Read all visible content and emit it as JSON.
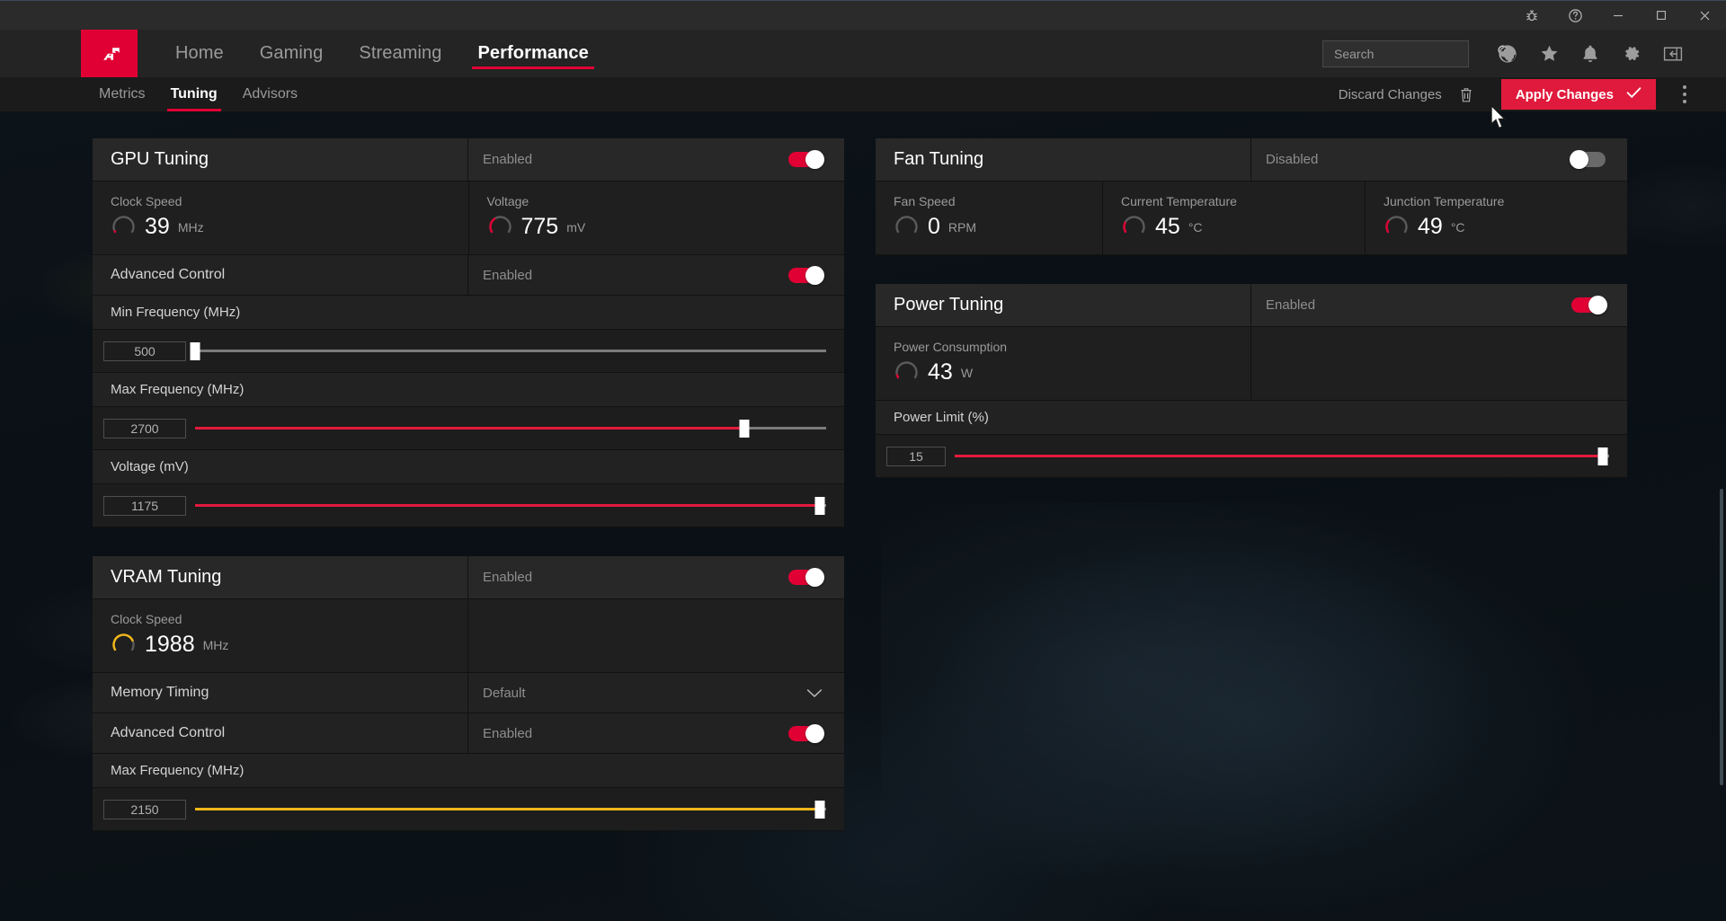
{
  "titlebar": {
    "buttons": [
      {
        "name": "bug-report-icon",
        "label": "Bug Report"
      },
      {
        "name": "help-icon",
        "label": "Help"
      },
      {
        "name": "minimize-icon",
        "label": "Minimize"
      },
      {
        "name": "maximize-icon",
        "label": "Maximize"
      },
      {
        "name": "close-icon",
        "label": "Close"
      }
    ]
  },
  "brand": {
    "logo": "amd-logo",
    "accent": "#e00034"
  },
  "nav": {
    "tabs": [
      {
        "label": "Home",
        "active": false
      },
      {
        "label": "Gaming",
        "active": false
      },
      {
        "label": "Streaming",
        "active": false
      },
      {
        "label": "Performance",
        "active": true
      }
    ],
    "search": {
      "placeholder": "Search",
      "value": "",
      "icon": "search-icon"
    },
    "icons": [
      {
        "name": "globe-icon",
        "label": "Browser"
      },
      {
        "name": "star-icon",
        "label": "Favorites"
      },
      {
        "name": "bell-icon",
        "label": "Notifications"
      },
      {
        "name": "gear-icon",
        "label": "Settings"
      },
      {
        "name": "panel-collapse-icon",
        "label": "Collapse Panel"
      }
    ]
  },
  "subnav": {
    "tabs": [
      {
        "label": "Metrics",
        "active": false
      },
      {
        "label": "Tuning",
        "active": true
      },
      {
        "label": "Advisors",
        "active": false
      }
    ],
    "discard_label": "Discard Changes",
    "discard_icon": "trash-icon",
    "apply_label": "Apply Changes",
    "apply_icon": "check-icon",
    "apply_color": "#e01a3c",
    "kebab_icon": "more-vertical-icon"
  },
  "panels": {
    "gpu_tuning": {
      "title": "GPU Tuning",
      "state_label": "Enabled",
      "state_on": true,
      "metrics": [
        {
          "label": "Clock Speed",
          "value": "39",
          "unit": "MHz",
          "gauge_pct": 6,
          "gauge_color": "#e00034"
        },
        {
          "label": "Voltage",
          "value": "775",
          "unit": "mV",
          "gauge_pct": 38,
          "gauge_color": "#e00034"
        }
      ],
      "advanced_control": {
        "label": "Advanced Control",
        "state_label": "Enabled",
        "state_on": true
      },
      "sliders": [
        {
          "label": "Min Frequency (MHz)",
          "value": "500",
          "fill_pct": 0,
          "color": "yellow",
          "filled": false
        },
        {
          "label": "Max Frequency (MHz)",
          "value": "2700",
          "fill_pct": 87,
          "color": "red",
          "filled": true
        },
        {
          "label": "Voltage (mV)",
          "value": "1175",
          "fill_pct": 99,
          "color": "red",
          "filled": true
        }
      ]
    },
    "vram_tuning": {
      "title": "VRAM Tuning",
      "state_label": "Enabled",
      "state_on": true,
      "metrics": [
        {
          "label": "Clock Speed",
          "value": "1988",
          "unit": "MHz",
          "gauge_pct": 78,
          "gauge_color": "#f2b619"
        }
      ],
      "memory_timing": {
        "label": "Memory Timing",
        "value": "Default",
        "icon": "chevron-down-icon"
      },
      "advanced_control": {
        "label": "Advanced Control",
        "state_label": "Enabled",
        "state_on": true
      },
      "sliders": [
        {
          "label": "Max Frequency (MHz)",
          "value": "2150",
          "fill_pct": 99,
          "color": "yellow",
          "filled": true
        }
      ]
    },
    "fan_tuning": {
      "title": "Fan Tuning",
      "state_label": "Disabled",
      "state_on": false,
      "metrics": [
        {
          "label": "Fan Speed",
          "value": "0",
          "unit": "RPM",
          "gauge_pct": 0,
          "gauge_color": "#e00034"
        },
        {
          "label": "Current Temperature",
          "value": "45",
          "unit": "°C",
          "gauge_pct": 26,
          "gauge_color": "#e00034"
        },
        {
          "label": "Junction Temperature",
          "value": "49",
          "unit": "°C",
          "gauge_pct": 30,
          "gauge_color": "#e00034"
        }
      ]
    },
    "power_tuning": {
      "title": "Power Tuning",
      "state_label": "Enabled",
      "state_on": true,
      "metrics": [
        {
          "label": "Power Consumption",
          "value": "43",
          "unit": "W",
          "gauge_pct": 10,
          "gauge_color": "#e00034"
        }
      ],
      "sliders": [
        {
          "label": "Power Limit (%)",
          "value": "15",
          "fill_pct": 99,
          "color": "red",
          "filled": true
        }
      ]
    }
  }
}
